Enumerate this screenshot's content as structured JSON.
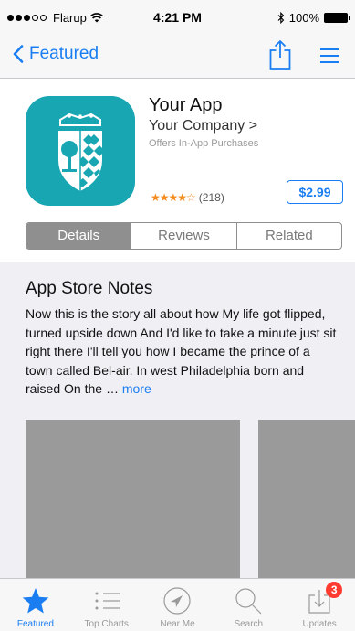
{
  "status_bar": {
    "carrier": "Flarup",
    "time": "4:21 PM",
    "battery": "100%"
  },
  "nav": {
    "back_label": "Featured"
  },
  "app": {
    "name": "Your App",
    "company": "Your Company >",
    "iap_note": "Offers In-App Purchases",
    "stars": "★★★★☆",
    "rating_count": "(218)",
    "rating_value": 4,
    "price": "$2.99",
    "icon_color": "#17a6b2"
  },
  "segments": [
    {
      "label": "Details",
      "active": true
    },
    {
      "label": "Reviews",
      "active": false
    },
    {
      "label": "Related",
      "active": false
    }
  ],
  "notes": {
    "title": "App Store Notes",
    "body": "Now this is the story all about how My life got flipped, turned upside down And I'd like to take a minute just sit right there I'll tell you how I became the prince of a town called Bel-air. In west Philadelphia born and raised On the … ",
    "more": "more"
  },
  "tabs": [
    {
      "label": "Featured",
      "icon": "star-icon",
      "active": true
    },
    {
      "label": "Top Charts",
      "icon": "list-icon",
      "active": false
    },
    {
      "label": "Near Me",
      "icon": "location-arrow-icon",
      "active": false
    },
    {
      "label": "Search",
      "icon": "search-icon",
      "active": false
    },
    {
      "label": "Updates",
      "icon": "download-tray-icon",
      "active": false,
      "badge": "3"
    }
  ],
  "colors": {
    "accent": "#1a7ef2",
    "badge": "#ff3b30",
    "star": "#f28c1f",
    "segment_active": "#8f8f8f",
    "screenshot_placeholder": "#9a9a9a"
  }
}
